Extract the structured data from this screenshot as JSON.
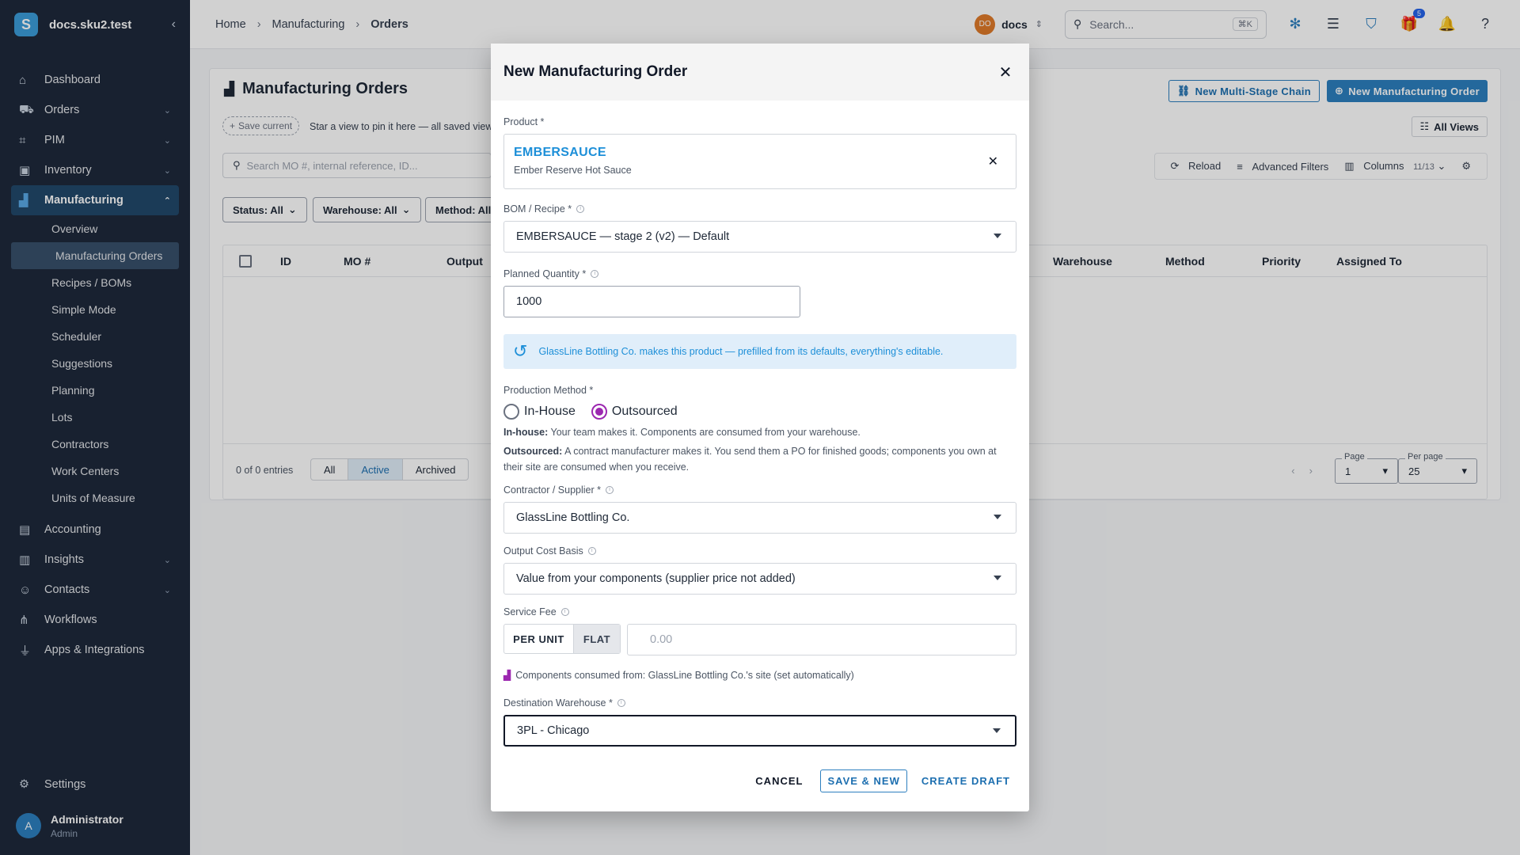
{
  "app": {
    "logo_letter": "S",
    "name": "docs.sku2.test"
  },
  "sidebar": {
    "items": [
      {
        "label": "Dashboard",
        "icon": "home-icon"
      },
      {
        "label": "Orders",
        "icon": "cart-icon"
      },
      {
        "label": "PIM",
        "icon": "tag-icon"
      },
      {
        "label": "Inventory",
        "icon": "box-icon"
      },
      {
        "label": "Manufacturing",
        "icon": "factory-icon"
      }
    ],
    "manufacturing_sub": [
      "Overview",
      "Manufacturing Orders",
      "Recipes / BOMs",
      "Simple Mode",
      "Scheduler",
      "Suggestions",
      "Planning",
      "Lots",
      "Contractors",
      "Work Centers",
      "Units of Measure"
    ],
    "items_after": [
      {
        "label": "Accounting",
        "icon": "book-icon"
      },
      {
        "label": "Insights",
        "icon": "chart-icon"
      },
      {
        "label": "Contacts",
        "icon": "people-icon"
      },
      {
        "label": "Workflows",
        "icon": "workflow-icon"
      },
      {
        "label": "Apps & Integrations",
        "icon": "plug-icon"
      }
    ],
    "settings": "Settings",
    "user": {
      "initial": "A",
      "name": "Administrator",
      "role": "Admin"
    }
  },
  "topbar": {
    "breadcrumb": [
      "Home",
      "Manufacturing",
      "Orders"
    ],
    "org_badge": "DO",
    "org_name": "docs",
    "search_placeholder": "Search...",
    "search_shortcut": "⌘K",
    "gift_badge": "5"
  },
  "page": {
    "title": "Manufacturing Orders",
    "btn_chain": "New Multi-Stage Chain",
    "btn_new": "New Manufacturing Order",
    "save_current": "Save current",
    "view_hint": "Star a view to pin it here — all saved view",
    "all_views": "All Views",
    "search_placeholder": "Search MO #, internal reference, ID...",
    "reload": "Reload",
    "advanced_filters": "Advanced Filters",
    "columns": "Columns",
    "columns_count": "11/13",
    "filters": [
      "Status: All",
      "Warehouse: All",
      "Method: All"
    ],
    "columns_head": [
      "ID",
      "MO #",
      "Output",
      "Warehouse",
      "Method",
      "Priority",
      "Assigned To"
    ],
    "entries": "0 of 0 entries",
    "status_tabs": [
      "All",
      "Active",
      "Archived"
    ],
    "page_label": "Page",
    "page_value": "1",
    "per_page_label": "Per page",
    "per_page_value": "25"
  },
  "modal": {
    "title": "New Manufacturing Order",
    "product_label": "Product *",
    "product_sku": "EMBERSAUCE",
    "product_name": "Ember Reserve Hot Sauce",
    "bom_label": "BOM / Recipe *",
    "bom_value": "EMBERSAUCE — stage 2 (v2) — Default",
    "qty_label": "Planned Quantity *",
    "qty_value": "1000",
    "alert": "GlassLine Bottling Co. makes this product — prefilled from its defaults, everything's editable.",
    "method_label": "Production Method *",
    "method_options": [
      "In-House",
      "Outsourced"
    ],
    "method_selected": "Outsourced",
    "help_inhouse_label": "In-house:",
    "help_inhouse": "Your team makes it. Components are consumed from your warehouse.",
    "help_outsourced_label": "Outsourced:",
    "help_outsourced": "A contract manufacturer makes it. You send them a PO for finished goods; components you own at their site are consumed when you receive.",
    "contractor_label": "Contractor / Supplier *",
    "contractor_value": "GlassLine Bottling Co.",
    "cost_label": "Output Cost Basis",
    "cost_value": "Value from your components (supplier price not added)",
    "fee_label": "Service Fee",
    "fee_modes": [
      "PER UNIT",
      "FLAT"
    ],
    "fee_mode_selected": "FLAT",
    "fee_placeholder": "0.00",
    "consume_note": "Components consumed from: GlassLine Bottling Co.'s site (set automatically)",
    "dest_label": "Destination Warehouse *",
    "dest_value": "3PL - Chicago",
    "cancel": "CANCEL",
    "save_new": "SAVE & NEW",
    "create_draft": "CREATE DRAFT"
  }
}
